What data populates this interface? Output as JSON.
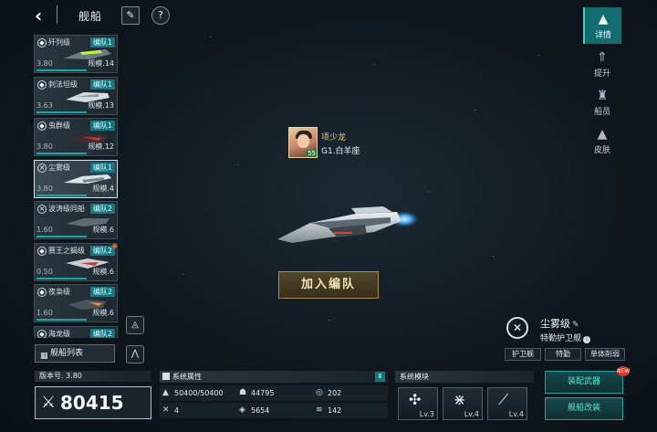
{
  "header": {
    "title": "舰船",
    "back_icon": "back-arrow-icon",
    "edit_icon": "pencil-icon",
    "help_icon": "help-icon",
    "help_glyph": "?"
  },
  "ship_list": [
    {
      "name": "歼列级",
      "group": "编队1",
      "level": "3.80",
      "scale": "规模.14",
      "selected": false,
      "alert": false
    },
    {
      "name": "刺法坦级",
      "group": "编队1",
      "level": "3.63",
      "scale": "规模.13",
      "selected": false,
      "alert": false
    },
    {
      "name": "虫群级",
      "group": "编队1",
      "level": "3.80",
      "scale": "规模.12",
      "selected": false,
      "alert": false
    },
    {
      "name": "尘雾级",
      "group": "编队1",
      "level": "3.80",
      "scale": "规模.4",
      "selected": true,
      "alert": false
    },
    {
      "name": "波涛级同船",
      "group": "编队2",
      "level": "1.60",
      "scale": "规模.6",
      "selected": false,
      "alert": false
    },
    {
      "name": "赛王之蝎级",
      "group": "编队2",
      "level": "0.50",
      "scale": "规模.6",
      "selected": false,
      "alert": true
    },
    {
      "name": "夜枭级",
      "group": "编队2",
      "level": "1.60",
      "scale": "规模.6",
      "selected": false,
      "alert": false
    },
    {
      "name": "海龙级",
      "group": "编队2",
      "level": "",
      "scale": "",
      "selected": false,
      "alert": false
    }
  ],
  "fleet_list_button": {
    "label": "舰船列表",
    "icon": "grid-icon"
  },
  "right_tabs": [
    {
      "label": "详情",
      "icon": "details-icon",
      "active": true
    },
    {
      "label": "提升",
      "icon": "upgrade-icon",
      "active": false
    },
    {
      "label": "船员",
      "icon": "crew-icon",
      "active": false
    },
    {
      "label": "皮肤",
      "icon": "skin-icon",
      "active": false
    }
  ],
  "captain": {
    "name": "项少龙",
    "constellation": "G1.白羊座",
    "level_badge": "55"
  },
  "join_button": {
    "label": "加入编队"
  },
  "ship_info": {
    "name": "尘雾级",
    "type": "特勤护卫舰",
    "info_glyph": "i",
    "tags": [
      "护卫舰",
      "特勤",
      "单体削弱"
    ]
  },
  "version": {
    "label": "版本号. 3.80"
  },
  "power": {
    "value": "80415",
    "icon": "crossed-swords-icon"
  },
  "attributes": {
    "title": "系统属性",
    "items": [
      {
        "icon": "hull-icon",
        "value": "50400/50400"
      },
      {
        "icon": "armor-icon",
        "value": "44795"
      },
      {
        "icon": "shield-icon",
        "value": "202"
      },
      {
        "icon": "speed-icon",
        "value": "4"
      },
      {
        "icon": "energy-icon",
        "value": "5654"
      },
      {
        "icon": "fuel-icon",
        "value": "142"
      }
    ]
  },
  "modules": {
    "title": "系统模块",
    "items": [
      {
        "icon": "weapon-module-icon",
        "level": "Lv.3"
      },
      {
        "icon": "satellite-module-icon",
        "level": "Lv.4"
      },
      {
        "icon": "radar-module-icon",
        "level": "Lv.4"
      }
    ]
  },
  "actions": {
    "equip_weapon": "装配武器",
    "modify_ship": "舰船改装",
    "new_badge": "NEW"
  },
  "colors": {
    "accent": "#1ea3a0",
    "gold": "#f0c66a",
    "alert": "#ff5a2a"
  }
}
